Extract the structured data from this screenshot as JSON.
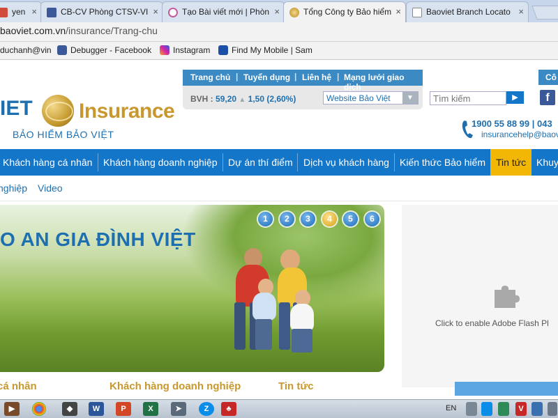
{
  "browser": {
    "tabs": [
      {
        "title": "yen d",
        "icon": "mail-icon"
      },
      {
        "title": "CB-CV Phòng CTSV-VI",
        "icon": "facebook-icon"
      },
      {
        "title": "Tạo Bài viết mới | Phòn",
        "icon": "wordpress-icon"
      },
      {
        "title": "Tổng Công ty Bảo hiểm",
        "icon": "baoviet-icon"
      },
      {
        "title": "Baoviet Branch Locato",
        "icon": "page-icon"
      }
    ],
    "close_glyph": "×",
    "url_host": "baoviet.com.vn",
    "url_path": "/insurance/Trang-chu",
    "bookmarks": [
      {
        "label": "duchanh@vin",
        "icon": "mail-icon"
      },
      {
        "label": "Debugger - Facebook",
        "icon": "facebook-icon"
      },
      {
        "label": "Instagram",
        "icon": "instagram-icon"
      },
      {
        "label": "Find My Mobile | Sam",
        "icon": "phone-icon"
      }
    ]
  },
  "site": {
    "logo_word": "IET",
    "logo_insurance": "Insurance",
    "logo_tagline": "BẢO HIỂM BẢO VIỆT",
    "top_nav": [
      "Trang chủ",
      "Tuyển dụng",
      "Liên hệ",
      "Mạng lưới giao dịch"
    ],
    "corner_tab": "Cô",
    "stock": {
      "label": "BVH :",
      "price": "59,20",
      "change": "1,50 (2,60%)"
    },
    "website_select": "Website Bảo Việt",
    "search_placeholder": "Tìm kiếm",
    "search_button": "▶",
    "facebook_glyph": "f",
    "hotline": "1900 55 88 99 | 043",
    "email": "insurancehelp@baov",
    "main_nav": [
      "Khách hàng cá nhân",
      "Khách hàng doanh nghiệp",
      "Dự án thí điểm",
      "Dịch vụ khách hàng",
      "Kiến thức Bảo hiểm",
      "Tin tức",
      "Khuy"
    ],
    "main_nav_active": "Tin tức",
    "sub_nav": [
      "nghiệp",
      "Video"
    ],
    "banner_headline": "O AN GIA ĐÌNH VIỆT",
    "slides": [
      "1",
      "2",
      "3",
      "4",
      "5",
      "6"
    ],
    "active_slide": "4",
    "flash_text": "Click to enable Adobe Flash Pl",
    "sections": [
      "cá nhân",
      "Khách hàng doanh nghiệp",
      "Tin tức"
    ]
  },
  "taskbar": {
    "lang": "EN",
    "apps": [
      "media",
      "chrome",
      "alien",
      "word",
      "powerpoint",
      "excel",
      "arrow",
      "zalo",
      "game"
    ]
  },
  "colors": {
    "brand_blue": "#1476c9",
    "gold": "#c8982e",
    "active_nav": "#f2b705"
  }
}
